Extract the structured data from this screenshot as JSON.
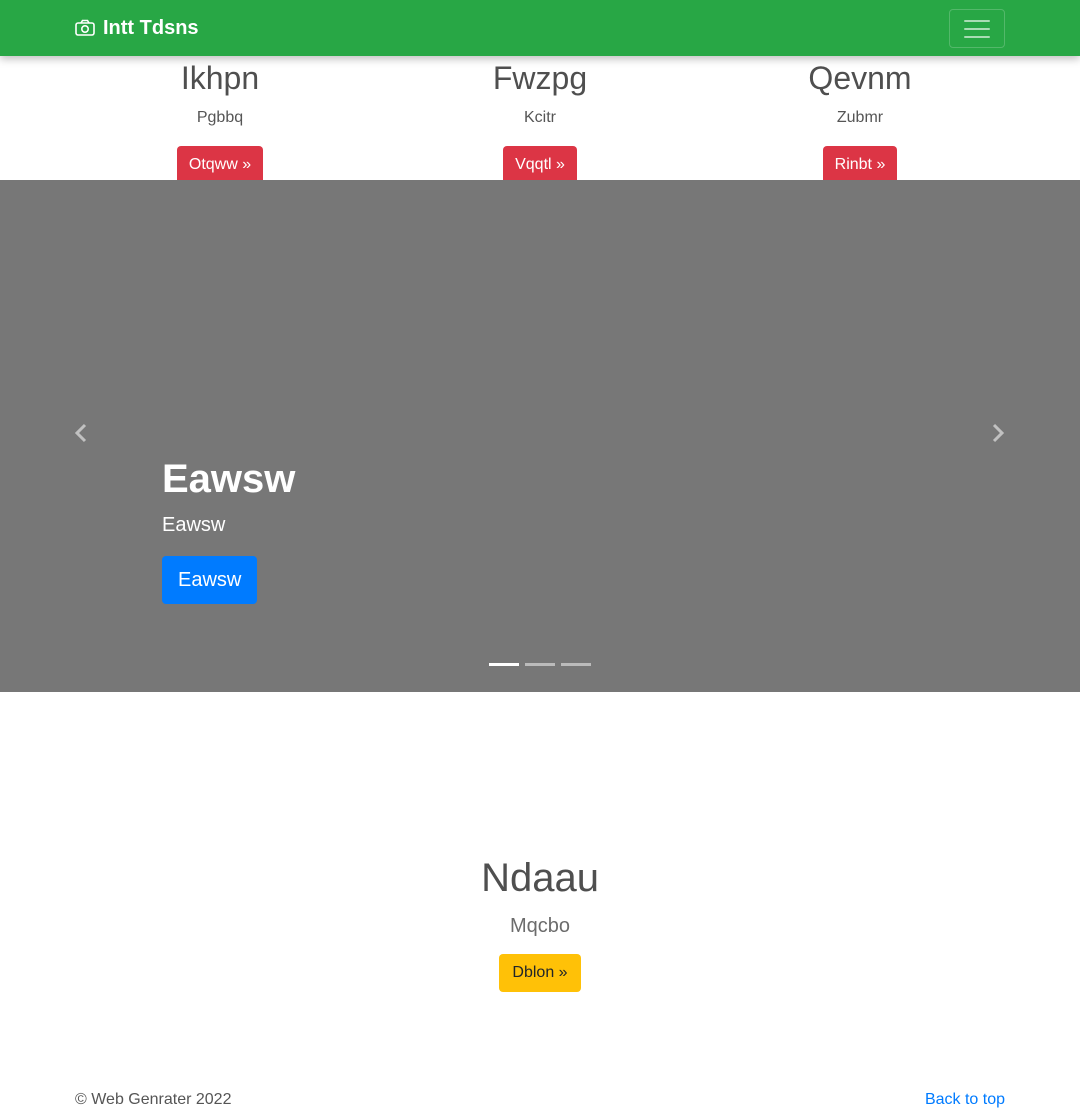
{
  "navbar": {
    "brand": "Intt Tdsns",
    "brand_icon": "camera-icon",
    "toggler_icon": "hamburger-icon",
    "color": "#28a745"
  },
  "features": [
    {
      "title": "Ikhpn",
      "text": "Pgbbq",
      "button": "Otqww »"
    },
    {
      "title": "Fwzpg",
      "text": "Kcitr",
      "button": "Vqqtl »"
    },
    {
      "title": "Qevnm",
      "text": "Zubmr",
      "button": "Rinbt »"
    }
  ],
  "carousel": {
    "heading": "Eawsw",
    "subtext": "Eawsw",
    "button": "Eawsw",
    "prev_icon": "chevron-left-icon",
    "next_icon": "chevron-right-icon",
    "slides": 3,
    "active_slide": 1,
    "background": "#777777"
  },
  "hero": {
    "title": "Ndaau",
    "subtitle": "Mqcbo",
    "button": "Dblon »"
  },
  "footer": {
    "copyright": "© Web Genrater 2022",
    "back_to_top": "Back to top"
  }
}
